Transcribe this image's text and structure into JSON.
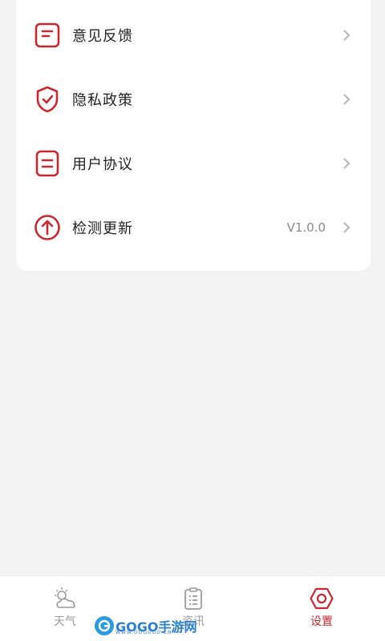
{
  "colors": {
    "accent": "#c8282f",
    "text": "#222222",
    "muted": "#888888",
    "background": "#f3f3f3"
  },
  "settings": {
    "items": [
      {
        "label": "意见反馈",
        "icon": "feedback-icon",
        "value": ""
      },
      {
        "label": "隐私政策",
        "icon": "shield-check-icon",
        "value": ""
      },
      {
        "label": "用户协议",
        "icon": "document-lines-icon",
        "value": ""
      },
      {
        "label": "检测更新",
        "icon": "arrow-up-circle-icon",
        "value": "V1.0.0"
      }
    ]
  },
  "tabbar": {
    "tabs": [
      {
        "label": "天气",
        "icon": "weather-icon",
        "active": false
      },
      {
        "label": "资讯",
        "icon": "clipboard-icon",
        "active": false
      },
      {
        "label": "设置",
        "icon": "settings-hexagon-icon",
        "active": true
      }
    ]
  },
  "watermark": {
    "text": "GOGO手游网",
    "sub": "WWW.GOGOGO.CN"
  }
}
